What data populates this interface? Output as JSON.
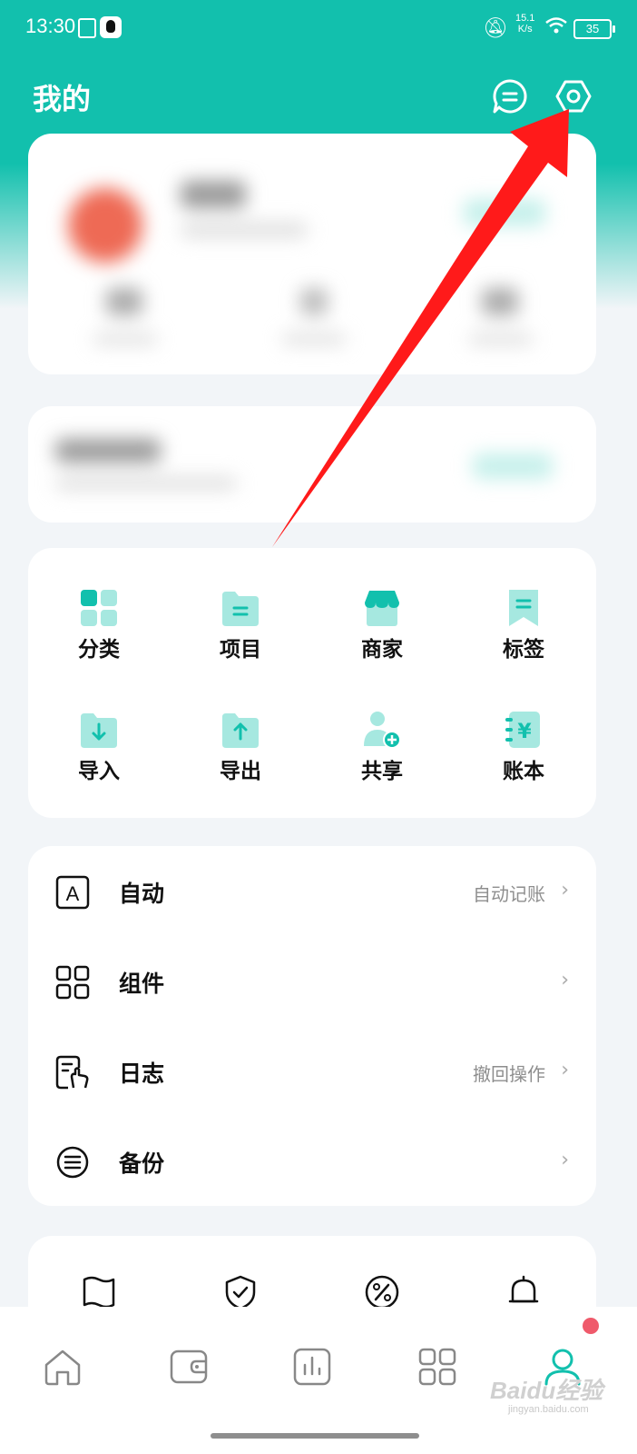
{
  "status_bar": {
    "time": "13:30",
    "speed_value": "15.1",
    "speed_unit": "K/s",
    "battery": "35"
  },
  "header": {
    "title": "我的"
  },
  "grid": {
    "items": [
      {
        "label": "分类",
        "icon": "category-icon"
      },
      {
        "label": "项目",
        "icon": "folder-icon"
      },
      {
        "label": "商家",
        "icon": "store-icon"
      },
      {
        "label": "标签",
        "icon": "bookmark-icon"
      },
      {
        "label": "导入",
        "icon": "import-icon"
      },
      {
        "label": "导出",
        "icon": "export-icon"
      },
      {
        "label": "共享",
        "icon": "share-user-icon"
      },
      {
        "label": "账本",
        "icon": "ledger-icon"
      }
    ]
  },
  "list": {
    "rows": [
      {
        "title": "自动",
        "value": "自动记账",
        "icon": "auto-a-icon"
      },
      {
        "title": "组件",
        "value": "",
        "icon": "widgets-icon"
      },
      {
        "title": "日志",
        "value": "撤回操作",
        "icon": "log-icon"
      },
      {
        "title": "备份",
        "value": "",
        "icon": "backup-icon"
      }
    ],
    "chevron": "›"
  },
  "watermark": {
    "brand": "Baidu经验",
    "url": "jingyan.baidu.com"
  },
  "colors": {
    "accent": "#12c0ad",
    "icon_light": "#a6e8e0",
    "arrow": "#ff1a1a",
    "badge": "#ef5a6b"
  }
}
